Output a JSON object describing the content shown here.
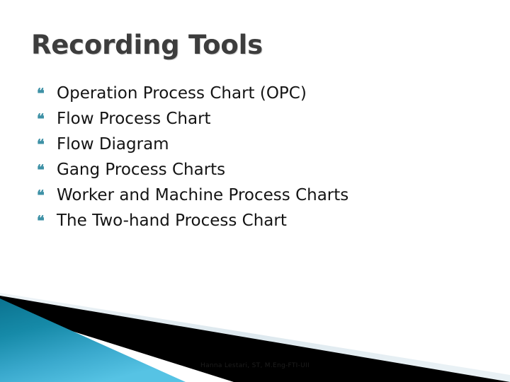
{
  "slide": {
    "title": "Recording Tools",
    "title_color": "#3d3d3d",
    "background_color": "#ffffff",
    "bullets": [
      {
        "bullet_glyph": "❝",
        "label": "Operation Process Chart (OPC)"
      },
      {
        "bullet_glyph": "❝",
        "label": "Flow Process Chart"
      },
      {
        "bullet_glyph": "❝",
        "label": "Flow Diagram"
      },
      {
        "bullet_glyph": "❝",
        "label": "Gang Process Charts"
      },
      {
        "bullet_glyph": "❝",
        "label": "Worker and Machine Process Charts"
      },
      {
        "bullet_glyph": "❝",
        "label": "The Two-hand Process Chart"
      }
    ],
    "bullet_color": "#3e91a6",
    "body_text_color": "#141414",
    "footer": "Hanna Lestari, ST, M.Eng-FTI-UII",
    "decoration": {
      "name": "diagonal-corner-graphic",
      "band_color": "#dfe9ef",
      "stripe_color": "#000000",
      "triangle_gradient_start": "#0b7390",
      "triangle_gradient_end": "#56c3e4"
    }
  }
}
